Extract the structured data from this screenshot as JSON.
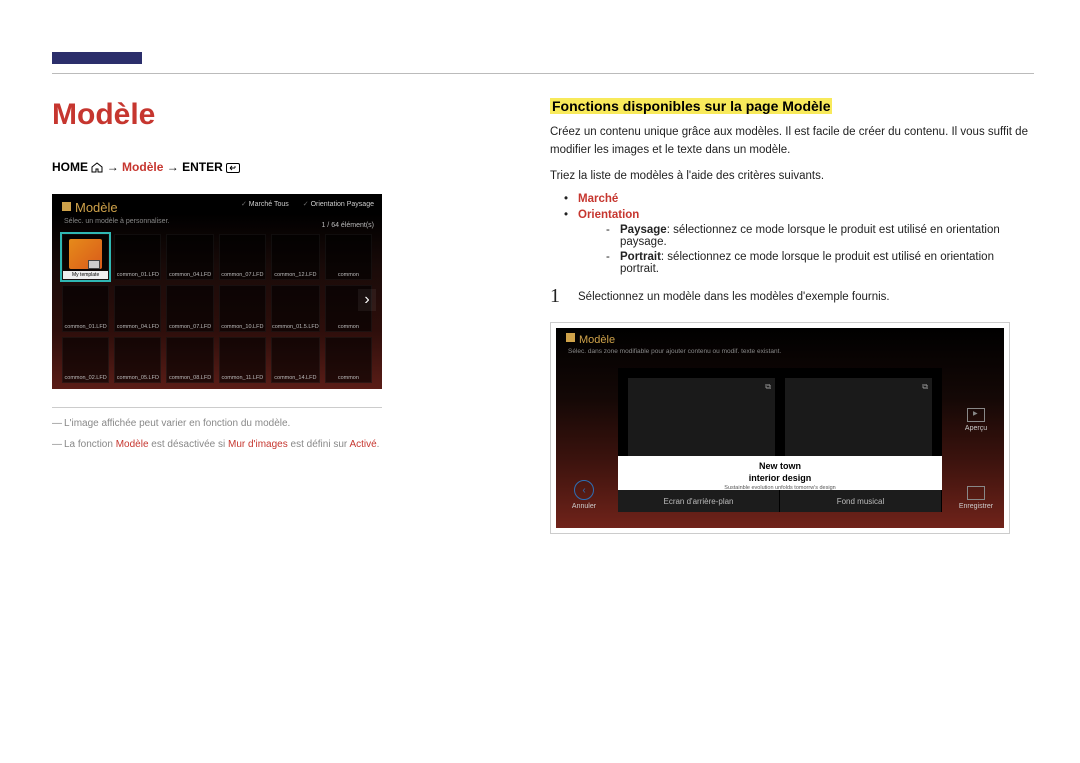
{
  "page_title": "Modèle",
  "breadcrumb": {
    "home": "HOME",
    "modele": "Modèle",
    "enter": "ENTER",
    "arrow": "→"
  },
  "shot1": {
    "title": "Modèle",
    "subtitle": "Sélec. un modèle à personnaliser.",
    "filter_marche": "Marché Tous",
    "filter_orient": "Orientation Paysage",
    "counter": "1 / 64 élément(s)",
    "selected_label": "My template",
    "thumbs": [
      "common_01.LFD",
      "common_04.LFD",
      "common_07.LFD",
      "common_10.LFD",
      "common_01.5.LFD",
      "common",
      "common_02.LFD",
      "common_05.LFD",
      "common_08.LFD",
      "common_11.LFD",
      "common_14.LFD",
      "common"
    ],
    "thumbs_row1": [
      "",
      "common_01.LFD",
      "common_04.LFD",
      "common_07.LFD",
      "common_12.LFD",
      "common"
    ]
  },
  "notes": {
    "note1": "L'image affichée peut varier en fonction du modèle.",
    "note2_pre": "La fonction ",
    "note2_modele": "Modèle",
    "note2_mid": " est désactivée si ",
    "note2_mur": "Mur d'images",
    "note2_mid2": " est défini sur ",
    "note2_active": "Activé",
    "note2_end": "."
  },
  "right": {
    "section_title": "Fonctions disponibles sur la page Modèle",
    "para1": "Créez un contenu unique grâce aux modèles. Il est facile de créer du contenu. Il vous suffit de modifier les images et le texte dans un modèle.",
    "para2": "Triez la liste de modèles à l'aide des critères suivants.",
    "marche": "Marché",
    "orientation": "Orientation",
    "paysage_label": "Paysage",
    "paysage_text": ": sélectionnez ce mode lorsque le produit est utilisé en orientation paysage.",
    "portrait_label": "Portrait",
    "portrait_text": ": sélectionnez ce mode lorsque le produit est utilisé en orientation portrait.",
    "step_num": "1",
    "step_text": "Sélectionnez un modèle dans les modèles d'exemple fournis."
  },
  "shot2": {
    "title": "Modèle",
    "subtitle": "Sélec. dans zone modifiable pour ajouter contenu ou modif. texte existant.",
    "headline": "New town",
    "subline": "interior design",
    "tagline": "Sustainble evolution unfolds tomorrw's design",
    "tab1": "Ecran d'arrière-plan",
    "tab2": "Fond musical",
    "cancel": "Annuler",
    "preview": "Aperçu",
    "save": "Enregistrer"
  }
}
